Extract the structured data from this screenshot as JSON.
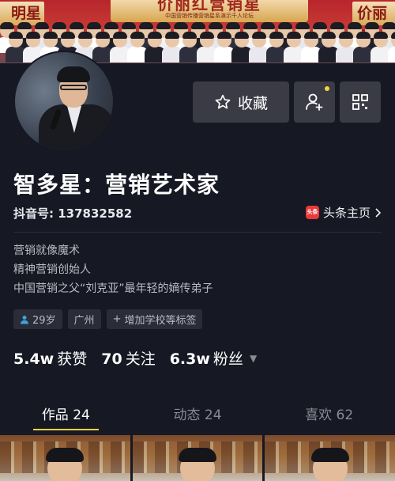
{
  "cover": {
    "banner_left": "明星",
    "banner_center_title": "价丽红营销星",
    "banner_center_sub": "中国营销传播营销星系演示千人论坛",
    "banner_right": "价丽星"
  },
  "header": {
    "collect_label": "收藏"
  },
  "profile": {
    "name": "智多星：营销艺术家",
    "douyin_id": "抖音号: 137832582",
    "toutiao_logo": "头条",
    "toutiao_link": "头条主页",
    "bio": [
      "营销就像魔术",
      "精神营销创始人",
      "中国营销之父“刘克亚”最年轻的嫡传弟子"
    ],
    "tags": {
      "age": "29岁",
      "city": "广州",
      "add_school": "增加学校等标签"
    },
    "stats": {
      "likes_value": "5.4w",
      "likes_label": "获赞",
      "following_value": "70",
      "following_label": "关注",
      "fans_value": "6.3w",
      "fans_label": "粉丝"
    }
  },
  "tabs": [
    {
      "label": "作品 24"
    },
    {
      "label": "动态 24"
    },
    {
      "label": "喜欢 62"
    }
  ],
  "colors": {
    "background": "#161823",
    "accent": "#f6d53b",
    "button": "#3a3b45"
  }
}
